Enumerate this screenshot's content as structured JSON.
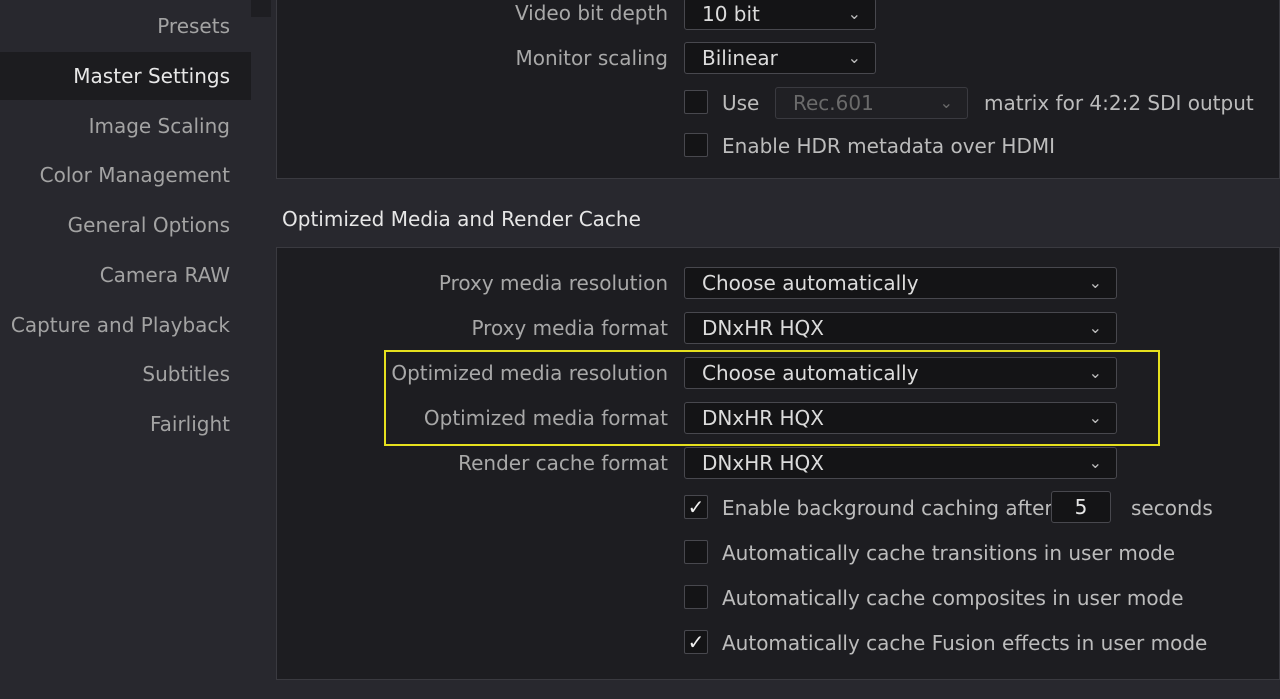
{
  "sidebar": {
    "items": [
      {
        "label": "Presets"
      },
      {
        "label": "Master Settings"
      },
      {
        "label": "Image Scaling"
      },
      {
        "label": "Color Management"
      },
      {
        "label": "General Options"
      },
      {
        "label": "Camera RAW"
      },
      {
        "label": "Capture and Playback"
      },
      {
        "label": "Subtitles"
      },
      {
        "label": "Fairlight"
      }
    ],
    "active_item": "Master Settings"
  },
  "video_monitoring": {
    "bit_depth": {
      "label": "Video bit depth",
      "value": "10 bit"
    },
    "monitor_scaling": {
      "label": "Monitor scaling",
      "value": "Bilinear"
    },
    "use_matrix": {
      "label_prefix": "Use",
      "value": "Rec.601",
      "label_suffix": "matrix for 4:2:2 SDI output",
      "checked": false,
      "disabled": true
    },
    "hdr_metadata": {
      "label": "Enable HDR metadata over HDMI",
      "checked": false
    }
  },
  "optimized_media": {
    "title": "Optimized Media and Render Cache",
    "proxy_resolution": {
      "label": "Proxy media resolution",
      "value": "Choose automatically"
    },
    "proxy_format": {
      "label": "Proxy media format",
      "value": "DNxHR HQX"
    },
    "optimized_resolution": {
      "label": "Optimized media resolution",
      "value": "Choose automatically"
    },
    "optimized_format": {
      "label": "Optimized media format",
      "value": "DNxHR HQX"
    },
    "render_cache_format": {
      "label": "Render cache format",
      "value": "DNxHR HQX"
    },
    "background_caching": {
      "label": "Enable background caching after",
      "checked": true,
      "seconds": "5",
      "unit": "seconds"
    },
    "cache_transitions": {
      "label": "Automatically cache transitions in user mode",
      "checked": false
    },
    "cache_composites": {
      "label": "Automatically cache composites in user mode",
      "checked": false
    },
    "cache_fusion": {
      "label": "Automatically cache Fusion effects in user mode",
      "checked": true
    }
  },
  "icons": {
    "chevron": "chevron-down-icon",
    "check": "checkmark-icon"
  },
  "colors": {
    "highlight": "#e6e01e",
    "panel": "#1d1d21",
    "background": "#28282e"
  }
}
